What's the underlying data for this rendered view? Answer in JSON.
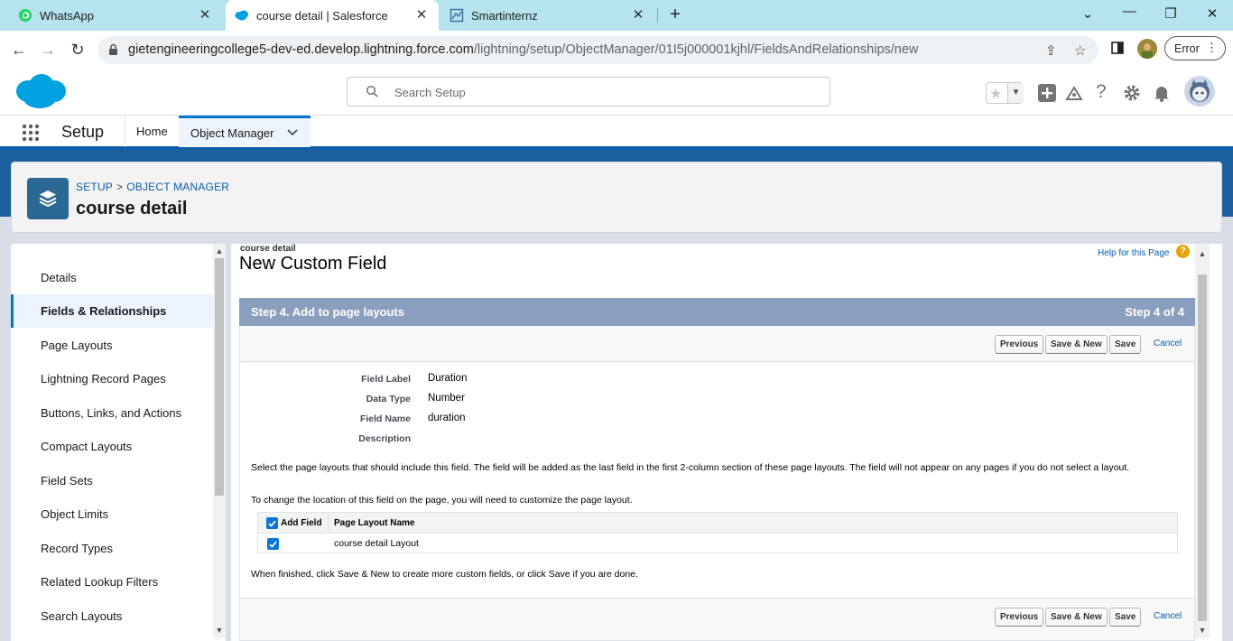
{
  "browser": {
    "tabs": [
      {
        "title": "WhatsApp",
        "icon": "whatsapp-icon"
      },
      {
        "title": "course detail | Salesforce",
        "icon": "salesforce-icon"
      },
      {
        "title": "Smartinternz",
        "icon": "smartinternz-icon"
      }
    ],
    "url_host": "gietengineeringcollege5-dev-ed.develop.lightning.force.com",
    "url_path": "/lightning/setup/ObjectManager/01I5j000001kjhl/FieldsAndRelationships/new",
    "error_label": "Error"
  },
  "sf_header": {
    "search_placeholder": "Search Setup"
  },
  "sf_nav": {
    "app_name": "Setup",
    "home": "Home",
    "object_manager": "Object Manager"
  },
  "object_header": {
    "crumb_setup": "SETUP",
    "crumb_sep": ">",
    "crumb_object_manager": "OBJECT MANAGER",
    "title": "course detail"
  },
  "leftnav": {
    "items": [
      "Details",
      "Fields & Relationships",
      "Page Layouts",
      "Lightning Record Pages",
      "Buttons, Links, and Actions",
      "Compact Layouts",
      "Field Sets",
      "Object Limits",
      "Record Types",
      "Related Lookup Filters",
      "Search Layouts"
    ],
    "active_index": 1
  },
  "main": {
    "object_label": "course detail",
    "page_title": "New Custom Field",
    "help_link": "Help for this Page",
    "help_q": "?",
    "step_title": "Step 4. Add to page layouts",
    "step_count": "Step 4 of 4",
    "buttons": {
      "previous": "Previous",
      "save_new": "Save & New",
      "save": "Save",
      "cancel": "Cancel"
    },
    "fields": [
      {
        "label": "Field Label",
        "value": "Duration"
      },
      {
        "label": "Data Type",
        "value": "Number"
      },
      {
        "label": "Field Name",
        "value": "duration"
      },
      {
        "label": "Description",
        "value": ""
      }
    ],
    "instruction_1": "Select the page layouts that should include this field. The field will be added as the last field in the first 2-column section of these page layouts. The field will not appear on any pages if you do not select a layout.",
    "instruction_2": "To change the location of this field on the page, you will need to customize the page layout.",
    "table": {
      "col_add_field": "Add Field",
      "col_layout_name": "Page Layout Name",
      "rows": [
        {
          "checked": true,
          "name": "course detail Layout"
        }
      ]
    },
    "finish_text": "When finished, click Save & New to create more custom fields, or click Save if you are done."
  }
}
